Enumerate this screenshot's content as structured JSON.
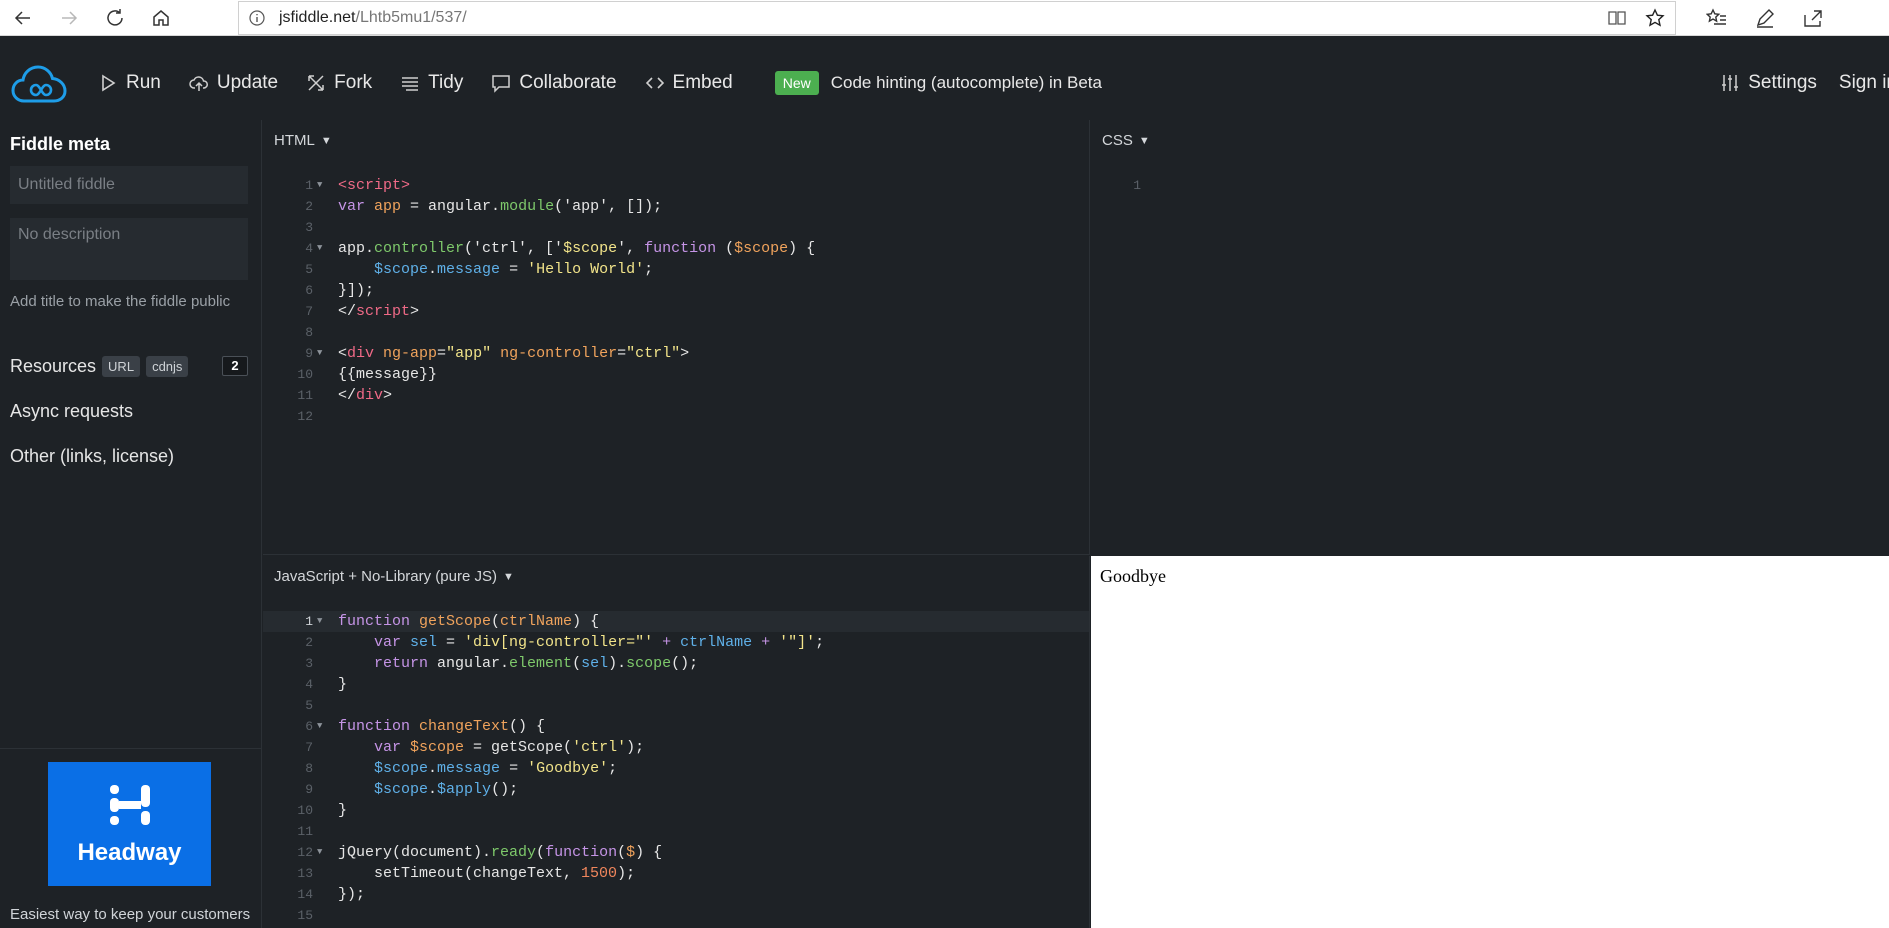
{
  "browser": {
    "url_host": "jsfiddle.net",
    "url_path": "/Lhtb5mu1/537/"
  },
  "toolbar": {
    "run": "Run",
    "update": "Update",
    "fork": "Fork",
    "tidy": "Tidy",
    "collaborate": "Collaborate",
    "embed": "Embed",
    "new_badge": "New",
    "beta_text": "Code hinting (autocomplete) in Beta",
    "settings": "Settings",
    "signin": "Sign in"
  },
  "sidebar": {
    "title": "Fiddle meta",
    "title_placeholder": "Untitled fiddle",
    "desc_placeholder": "No description",
    "hint": "Add title to make the fiddle public",
    "resources": "Resources",
    "url_pill": "URL",
    "cdnjs_pill": "cdnjs",
    "resources_count": "2",
    "async": "Async requests",
    "other": "Other (links, license)",
    "ad_name": "Headway",
    "ad_caption": "Easiest way to keep your customers"
  },
  "panels": {
    "html_label": "HTML",
    "css_label": "CSS",
    "js_label": "JavaScript + No-Library (pure JS)",
    "result_text": "Goodbye"
  },
  "html_code": {
    "l1": "<script>",
    "l2a": "var ",
    "l2b": "app",
    "l2c": " = angular.",
    "l2d": "module",
    "l2e": "('app', []);",
    "l4a": "app.",
    "l4b": "controller",
    "l4c": "('ctrl', ['",
    "l4d": "$scope",
    "l4e": "', ",
    "l4f": "function",
    "l4g": " (",
    "l4h": "$scope",
    "l4i": ") {",
    "l5a": "    ",
    "l5b": "$scope",
    "l5c": ".",
    "l5d": "message",
    "l5e": " = ",
    "l5f": "'Hello World'",
    "l5g": ";",
    "l6": "}]);",
    "l7a": "</",
    "l7b": "script",
    "l7c": ">",
    "l9a": "<",
    "l9b": "div",
    "l9c": " ng-app",
    "l9d": "=",
    "l9e": "\"app\"",
    "l9f": " ng-controller",
    "l9g": "=",
    "l9h": "\"ctrl\"",
    "l9i": ">",
    "l10": "{{message}}",
    "l11a": "</",
    "l11b": "div",
    "l11c": ">"
  },
  "js_code": {
    "l1a": "function ",
    "l1b": "getScope",
    "l1c": "(",
    "l1d": "ctrlName",
    "l1e": ") {",
    "l2a": "    var ",
    "l2b": "sel",
    "l2c": " = ",
    "l2d": "'div[ng-controller=\"'",
    "l2e": " + ",
    "l2f": "ctrlName",
    "l2g": " + ",
    "l2h": "'\"]'",
    "l2i": ";",
    "l3a": "    return ",
    "l3b": "angular.",
    "l3c": "element",
    "l3d": "(",
    "l3e": "sel",
    "l3f": ").",
    "l3g": "scope",
    "l3h": "();",
    "l4": "}",
    "l6a": "function ",
    "l6b": "changeText",
    "l6c": "() {",
    "l7a": "    var ",
    "l7b": "$scope",
    "l7c": " = getScope(",
    "l7d": "'ctrl'",
    "l7e": ");",
    "l8a": "    ",
    "l8b": "$scope",
    "l8c": ".",
    "l8d": "message",
    "l8e": " = ",
    "l8f": "'Goodbye'",
    "l8g": ";",
    "l9a": "    ",
    "l9b": "$scope",
    "l9c": ".",
    "l9d": "$apply",
    "l9e": "();",
    "l10": "}",
    "l12a": "jQuery(document).",
    "l12b": "ready",
    "l12c": "(",
    "l12d": "function",
    "l12e": "(",
    "l12f": "$",
    "l12g": ") {",
    "l13a": "    setTimeout(changeText, ",
    "l13b": "1500",
    "l13c": ");",
    "l14": "});"
  },
  "line_numbers": [
    "1",
    "2",
    "3",
    "4",
    "5",
    "6",
    "7",
    "8",
    "9",
    "10",
    "11",
    "12",
    "13",
    "14",
    "15"
  ],
  "css_line_number": "1",
  "colors": {
    "background": "#1e2226",
    "accent_green": "#4caf50",
    "ad_blue": "#0a6fe6"
  }
}
